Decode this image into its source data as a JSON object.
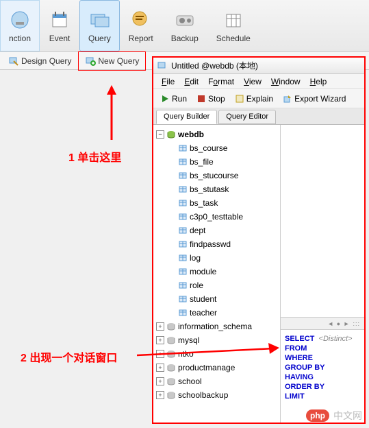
{
  "main_toolbar": {
    "items": [
      {
        "label": "nction",
        "name": "function-button"
      },
      {
        "label": "Event",
        "name": "event-button"
      },
      {
        "label": "Query",
        "name": "query-button",
        "active": true
      },
      {
        "label": "Report",
        "name": "report-button"
      },
      {
        "label": "Backup",
        "name": "backup-button"
      },
      {
        "label": "Schedule",
        "name": "schedule-button"
      }
    ]
  },
  "sec_toolbar": {
    "design_query": "Design Query",
    "new_query": "New Query"
  },
  "subwin": {
    "title": "Untitled @webdb (本地)"
  },
  "menubar": {
    "items": [
      {
        "text": "File",
        "u": "F"
      },
      {
        "text": "Edit",
        "u": "E"
      },
      {
        "text": "Format",
        "u": "o"
      },
      {
        "text": "View",
        "u": "V"
      },
      {
        "text": "Window",
        "u": "W"
      },
      {
        "text": "Help",
        "u": "H"
      }
    ]
  },
  "actionbar": {
    "run": "Run",
    "stop": "Stop",
    "explain": "Explain",
    "export": "Export Wizard"
  },
  "tabs": {
    "qb": "Query Builder",
    "qe": "Query Editor"
  },
  "tree": {
    "root": {
      "label": "webdb",
      "expanded": true
    },
    "tables": [
      "bs_course",
      "bs_file",
      "bs_stucourse",
      "bs_stutask",
      "bs_task",
      "c3p0_testtable",
      "dept",
      "findpasswd",
      "log",
      "module",
      "role",
      "student",
      "teacher"
    ],
    "other_dbs": [
      "information_schema",
      "mysql",
      "ntko",
      "productmanage",
      "school",
      "schoolbackup"
    ]
  },
  "sql": {
    "keywords": [
      "SELECT",
      "FROM",
      "WHERE",
      "GROUP BY",
      "HAVING",
      "ORDER BY",
      "LIMIT"
    ],
    "distinct": "<Distinct>"
  },
  "annotations": {
    "step1": "1 单击这里",
    "step2": "2 出现一个对话窗口"
  },
  "watermark": {
    "logo": "php",
    "text": "中文网"
  }
}
